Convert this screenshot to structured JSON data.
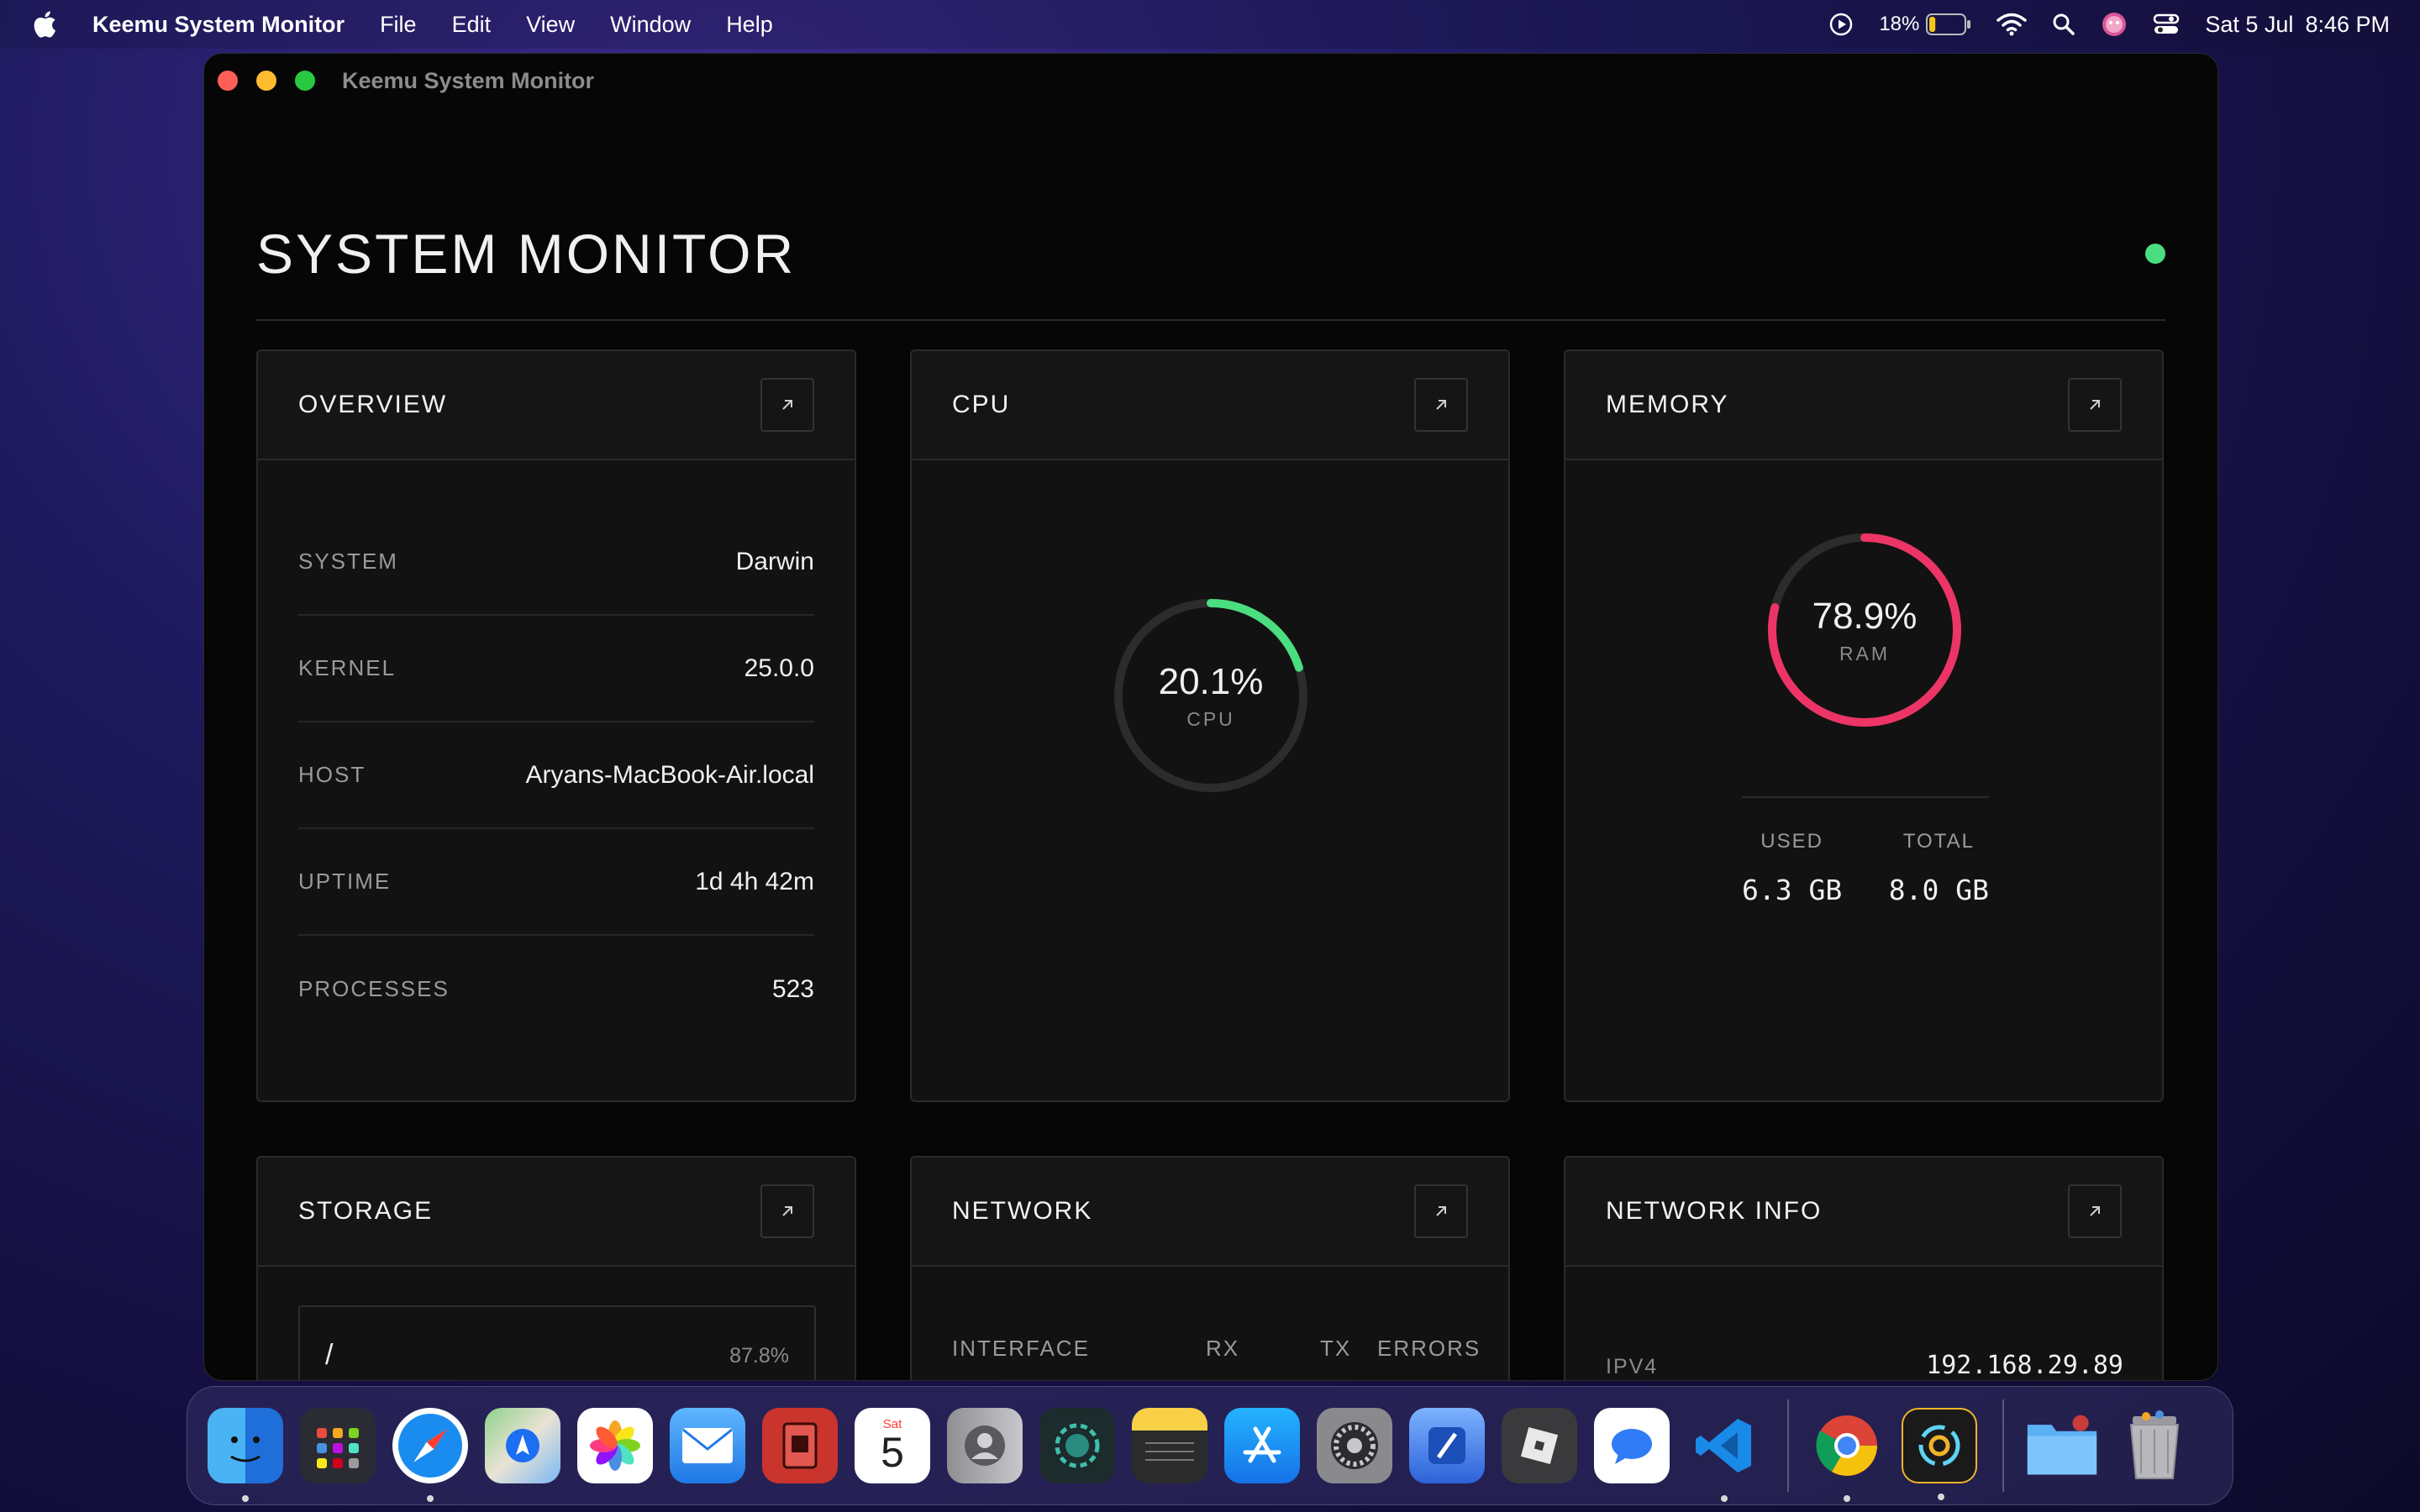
{
  "menubar": {
    "app_name": "Keemu System Monitor",
    "menus": [
      "File",
      "Edit",
      "View",
      "Window",
      "Help"
    ],
    "battery_percent": "18%",
    "battery_level": 0.18,
    "date": "Sat 5 Jul",
    "time": "8:46 PM"
  },
  "window": {
    "title": "Keemu System Monitor"
  },
  "header": {
    "title": "SYSTEM MONITOR",
    "status_color": "#4ade80"
  },
  "overview": {
    "title": "OVERVIEW",
    "rows": [
      {
        "key": "SYSTEM",
        "value": "Darwin"
      },
      {
        "key": "KERNEL",
        "value": "25.0.0"
      },
      {
        "key": "HOST",
        "value": "Aryans-MacBook-Air.local"
      },
      {
        "key": "UPTIME",
        "value": "1d 4h 42m"
      },
      {
        "key": "PROCESSES",
        "value": "523"
      }
    ]
  },
  "cpu": {
    "title": "CPU",
    "percent_text": "20.1%",
    "percent": 20.1,
    "label": "CPU",
    "color": "#4ade80"
  },
  "memory": {
    "title": "MEMORY",
    "percent_text": "78.9%",
    "percent": 78.9,
    "label": "RAM",
    "color": "#ec3566",
    "used_label": "USED",
    "used_value": "6.3 GB",
    "total_label": "TOTAL",
    "total_value": "8.0 GB"
  },
  "storage": {
    "title": "STORAGE",
    "items": [
      {
        "mount": "/",
        "percent": "87.8%"
      }
    ]
  },
  "network": {
    "title": "NETWORK",
    "columns": [
      "INTERFACE",
      "RX",
      "TX",
      "ERRORS"
    ]
  },
  "network_info": {
    "title": "NETWORK INFO",
    "rows": [
      {
        "key": "IPV4",
        "value": "192.168.29.89"
      }
    ]
  },
  "dock": {
    "calendar_day": "Sat",
    "calendar_date": "5",
    "apps": [
      "finder-icon",
      "launchpad-icon",
      "safari-icon",
      "maps-icon",
      "photos-icon",
      "mail-icon",
      "app-icon",
      "calendar-icon",
      "contacts-icon",
      "app-icon",
      "notes-icon",
      "app-store-icon",
      "system-settings-icon",
      "xcode-icon",
      "roblox-icon",
      "messages-icon",
      "vscode-icon",
      "chrome-icon",
      "keemu-icon",
      "downloads-folder-icon",
      "trash-icon"
    ]
  }
}
